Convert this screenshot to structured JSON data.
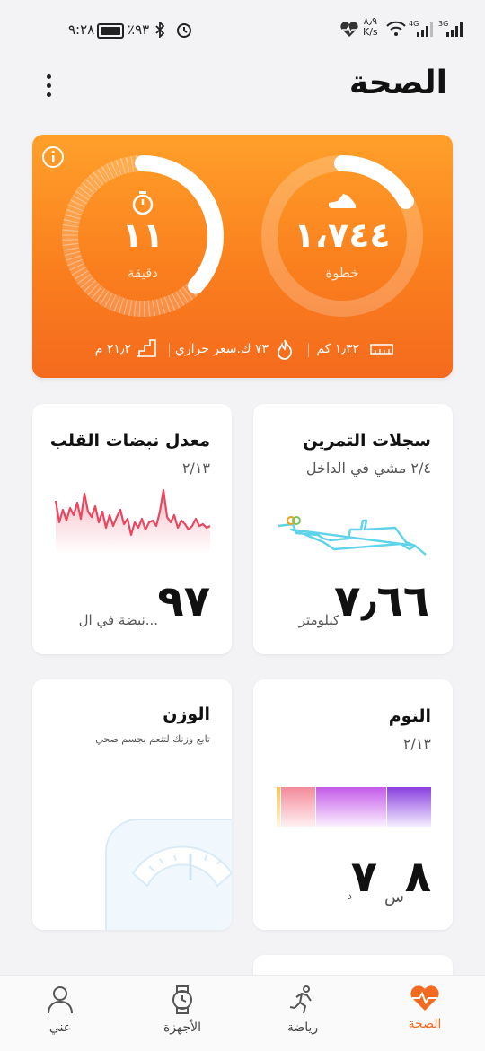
{
  "status_bar": {
    "time": "٩:٢٨",
    "battery": "٪٩٣",
    "speed_value": "٨٫٩",
    "speed_unit": "K/s",
    "net1": "4G",
    "net2": "3G"
  },
  "header": {
    "title": "الصحة"
  },
  "activity": {
    "steps_value": "١،٧٤٤",
    "steps_label": "خطوة",
    "minutes_value": "١١",
    "minutes_label": "دقيقة",
    "steps_progress": 0.17,
    "minutes_progress": 0.37,
    "distance": "١٫٣٢ كم",
    "calories": "٧٣ ك.سعر حراري",
    "floors": "٢١٫٢ م"
  },
  "exercise_card": {
    "title": "سجلات التمرين",
    "subtitle": "٢/٤ مشي في الداخل",
    "value": "٧٫٦٦",
    "unit": "كيلومتر"
  },
  "heart_card": {
    "title": "معدل نبضات القلب",
    "date": "٢/١٣",
    "value": "٩٧",
    "unit": "نبضة في ال..."
  },
  "sleep_card": {
    "title": "النوم",
    "date": "٢/١٣",
    "hours": "٨",
    "hours_unit": "س",
    "minutes": "٧",
    "minutes_unit": "د"
  },
  "weight_card": {
    "title": "الوزن",
    "subtitle": "تابع وزنك لتنعم بجسم صحي"
  },
  "bottom_nav": {
    "health": "الصحة",
    "exercise": "رياضة",
    "devices": "الأجهزة",
    "me": "عني"
  },
  "colors": {
    "accent": "#f26b20",
    "heart_line": "#e8475f",
    "route": "#5fd3ea"
  }
}
